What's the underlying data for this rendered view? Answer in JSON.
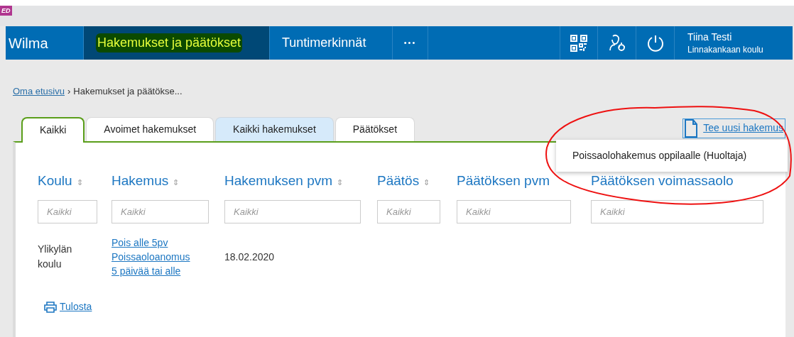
{
  "logo": {
    "text": "ED"
  },
  "nav": {
    "brand": "Wilma",
    "items": [
      {
        "label": "Hakemukset ja päätökset",
        "selected": true,
        "highlighted": true
      },
      {
        "label": "Tuntimerkinnät",
        "selected": false,
        "highlighted": false
      }
    ],
    "more": "•••",
    "user": {
      "name": "Tiina Testi",
      "school": "Linnakankaan koulu"
    }
  },
  "breadcrumb": {
    "home": "Oma etusivu",
    "separator": "›",
    "current": "Hakemukset ja päätökse..."
  },
  "tabs": [
    {
      "label": "Kaikki",
      "selected": true,
      "hovered": false
    },
    {
      "label": "Avoimet hakemukset",
      "selected": false,
      "hovered": false
    },
    {
      "label": "Kaikki hakemukset",
      "selected": false,
      "hovered": true
    },
    {
      "label": "Päätökset",
      "selected": false,
      "hovered": false
    }
  ],
  "new_application": {
    "label": "Tee uusi hakemus",
    "expanded": true,
    "menu": [
      "Poissaolohakemus oppilaalle (Huoltaja)"
    ]
  },
  "table": {
    "columns": [
      {
        "label": "Koulu",
        "sort": "⇕",
        "placeholder": "Kaikki"
      },
      {
        "label": "Hakemus",
        "sort": "⇕",
        "placeholder": "Kaikki"
      },
      {
        "label": "Hakemuksen pvm",
        "sort": "⇕",
        "placeholder": "Kaikki"
      },
      {
        "label": "Päätös",
        "sort": "⇕",
        "placeholder": "Kaikki"
      },
      {
        "label": "Päätöksen pvm",
        "placeholder": "Kaikki"
      },
      {
        "label": "Päätöksen voimassaolo",
        "placeholder": "Kaikki"
      }
    ],
    "rows": [
      {
        "school": "Ylikylän koulu",
        "application": [
          "Pois alle 5pv",
          "Poissaoloanomus 5 päivää tai alle"
        ],
        "date": "18.02.2020"
      }
    ]
  },
  "print": "Tulosta"
}
